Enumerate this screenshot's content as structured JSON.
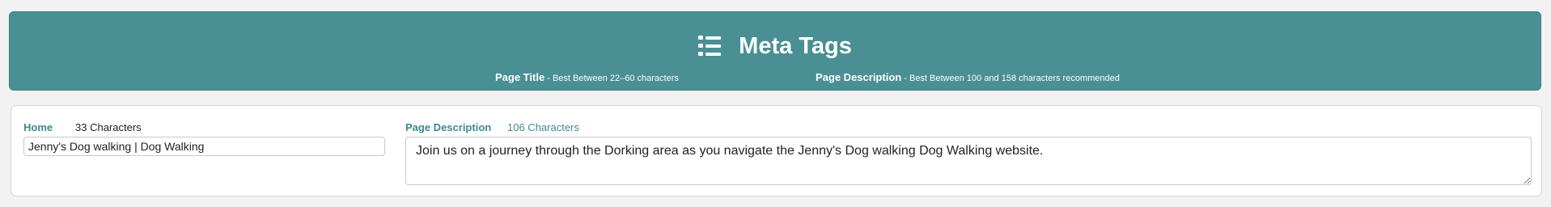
{
  "header": {
    "icon": "list-icon",
    "title": "Meta Tags",
    "title_hint": {
      "label": "Page Title",
      "text": " - Best Between 22–60 characters"
    },
    "description_hint": {
      "label": "Page Description",
      "text": " - Best Between 100 and 158 characters recommended"
    },
    "background_color": "#4a8f93"
  },
  "page": {
    "title_label": "Home",
    "title_count": "33 Characters",
    "title_value": "Jenny's Dog walking | Dog Walking",
    "description_label": "Page Description",
    "description_count": "106 Characters",
    "description_value": "Join us on a journey through the Dorking area as you navigate the Jenny's Dog walking Dog Walking website.",
    "accent_color": "#3d8a8e"
  }
}
